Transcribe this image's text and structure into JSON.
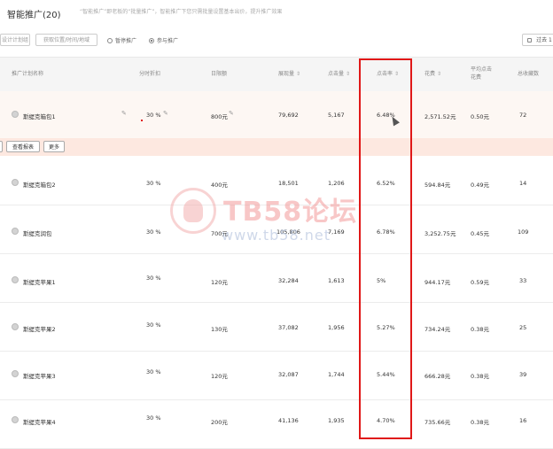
{
  "page": {
    "title": "智能推广(20)",
    "description": "“智能推广”即老板的“批量推广”，智能推广下您只需批量设置基本出价，提升推广效果"
  },
  "toolbar": {
    "buttons": [
      "设计计划组",
      "获取位置/时间/地域"
    ],
    "radios": [
      {
        "label": "暂停推广",
        "checked": false
      },
      {
        "label": "参与推广",
        "checked": true
      }
    ],
    "right_button": "过去 1"
  },
  "table": {
    "headers": [
      "推广计划名称",
      "分时折扣",
      "日限额",
      "展现量",
      "点击量",
      "点击率",
      "花费",
      "平均点击花费",
      "总收藏数"
    ],
    "rows": [
      {
        "name": "斯缇克箱包1",
        "discount": "30 %",
        "daily_limit": "800元",
        "impressions": "79,692",
        "clicks": "5,167",
        "ctr": "6.48%",
        "cost": "2,571.52元",
        "avg_cpc": "0.50元",
        "favorites": "72"
      },
      {
        "name": "斯缇克箱包2",
        "discount": "30 %",
        "daily_limit": "400元",
        "impressions": "18,501",
        "clicks": "1,206",
        "ctr": "6.52%",
        "cost": "594.84元",
        "avg_cpc": "0.49元",
        "favorites": "14"
      },
      {
        "name": "斯缇克润包",
        "discount": "30 %",
        "daily_limit": "700元",
        "impressions": "105,806",
        "clicks": "7,169",
        "ctr": "6.78%",
        "cost": "3,252.75元",
        "avg_cpc": "0.45元",
        "favorites": "109"
      },
      {
        "name": "斯缇克苹果1",
        "discount": "30 %",
        "daily_limit": "120元",
        "impressions": "32,284",
        "clicks": "1,613",
        "ctr": "5%",
        "cost": "944.17元",
        "avg_cpc": "0.59元",
        "favorites": "33"
      },
      {
        "name": "斯缇克苹果2",
        "discount": "30 %",
        "daily_limit": "130元",
        "impressions": "37,082",
        "clicks": "1,956",
        "ctr": "5.27%",
        "cost": "734.24元",
        "avg_cpc": "0.38元",
        "favorites": "25"
      },
      {
        "name": "斯缇克苹果3",
        "discount": "30 %",
        "daily_limit": "120元",
        "impressions": "32,087",
        "clicks": "1,744",
        "ctr": "5.44%",
        "cost": "666.28元",
        "avg_cpc": "0.38元",
        "favorites": "39"
      },
      {
        "name": "斯缇克苹果4",
        "discount": "30 %",
        "daily_limit": "200元",
        "impressions": "41,136",
        "clicks": "1,935",
        "ctr": "4.70%",
        "cost": "735.66元",
        "avg_cpc": "0.38元",
        "favorites": "16"
      }
    ]
  },
  "row_actions": [
    "查看报表",
    "更多"
  ],
  "watermark": {
    "brand": "TB58论坛",
    "url": "www.tb58.net"
  },
  "colors": {
    "highlight": "#e01818",
    "selected_row": "#fdf7f3",
    "action_bar": "#fde8e0"
  },
  "icons": {
    "edit": "pencil-icon",
    "sort": "sort-icon",
    "row_select": "radio-circle-icon"
  }
}
